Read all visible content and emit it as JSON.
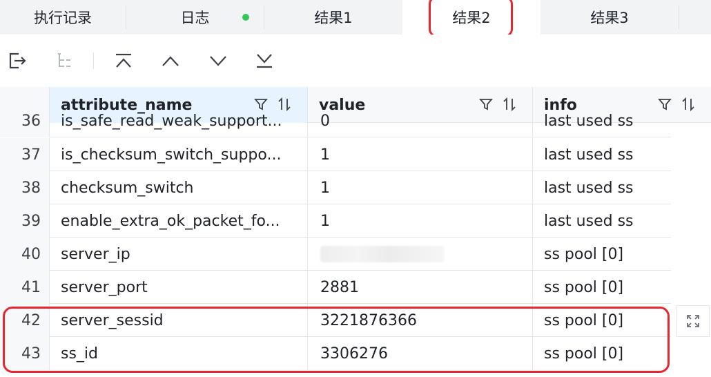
{
  "tabs": [
    {
      "label": "执行记录",
      "active": false,
      "dot": false
    },
    {
      "label": "日志",
      "active": false,
      "dot": true
    },
    {
      "label": "结果1",
      "active": false,
      "dot": false
    },
    {
      "label": "结果2",
      "active": true,
      "dot": false
    },
    {
      "label": "结果3",
      "active": false,
      "dot": false
    }
  ],
  "toolbar": {
    "icons": [
      "export-icon",
      "tree-view-icon",
      "scroll-to-top-icon",
      "previous-icon",
      "next-icon",
      "scroll-to-bottom-icon"
    ]
  },
  "columns": [
    {
      "label": "attribute_name"
    },
    {
      "label": "value"
    },
    {
      "label": "info"
    }
  ],
  "rows": [
    {
      "num": "36",
      "attribute_name": "is_safe_read_weak_support...",
      "value": "0",
      "info": "last used ss"
    },
    {
      "num": "37",
      "attribute_name": "is_checksum_switch_suppo...",
      "value": "1",
      "info": "last used ss"
    },
    {
      "num": "38",
      "attribute_name": "checksum_switch",
      "value": "1",
      "info": "last used ss"
    },
    {
      "num": "39",
      "attribute_name": "enable_extra_ok_packet_fo...",
      "value": "1",
      "info": "last used ss"
    },
    {
      "num": "40",
      "attribute_name": "server_ip",
      "value": "",
      "info": "ss pool [0]"
    },
    {
      "num": "41",
      "attribute_name": "server_port",
      "value": "2881",
      "info": "ss pool [0]"
    },
    {
      "num": "42",
      "attribute_name": "server_sessid",
      "value": "3221876366",
      "info": "ss pool [0]"
    },
    {
      "num": "43",
      "attribute_name": "ss_id",
      "value": "3306276",
      "info": "ss pool [0]"
    }
  ],
  "colors": {
    "highlight": "#e8262d",
    "status_dot": "#33c758",
    "header_selected": "#e7f3ff"
  }
}
